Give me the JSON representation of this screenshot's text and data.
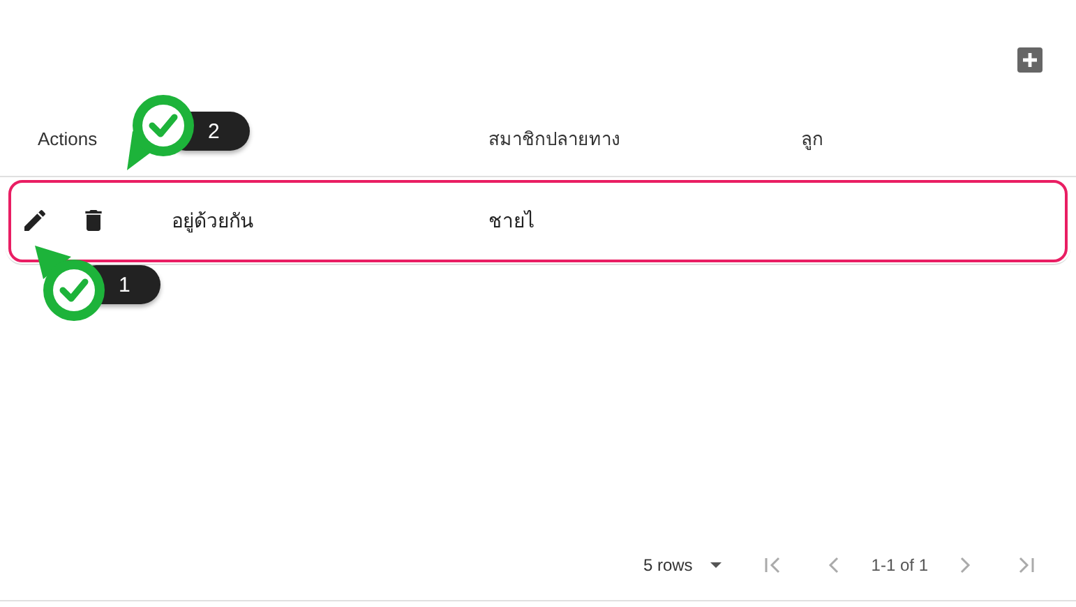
{
  "table": {
    "columns": [
      {
        "label": "Actions"
      },
      {
        "label": "สมาชิกปลายทาง"
      },
      {
        "label": "ลูก"
      }
    ],
    "rows": [
      {
        "column_2": "อยู่ด้วยกัน",
        "column_3": "ชายไ",
        "highlighted": true
      }
    ]
  },
  "markers": [
    {
      "number": "1",
      "kind": "upward"
    },
    {
      "number": "2",
      "kind": "downward"
    }
  ],
  "pagination": {
    "rows_per_page": "5 rows",
    "range": "1-1 of 1"
  }
}
